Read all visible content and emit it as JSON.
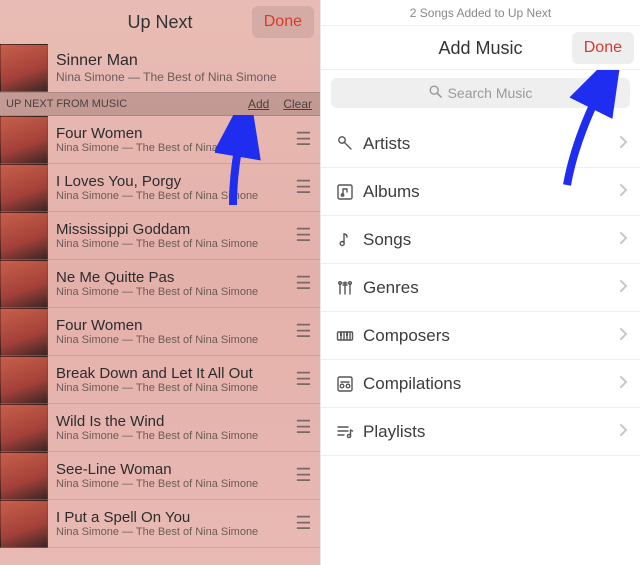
{
  "left": {
    "title": "Up Next",
    "done": "Done",
    "now_playing": {
      "title": "Sinner Man",
      "subtitle": "Nina Simone — The Best of Nina Simone"
    },
    "section_label": "UP NEXT FROM MUSIC",
    "add": "Add",
    "clear": "Clear",
    "queue": [
      {
        "title": "Four Women",
        "subtitle": "Nina Simone — The Best of Nina Simone"
      },
      {
        "title": "I Loves You, Porgy",
        "subtitle": "Nina Simone — The Best of Nina Simone"
      },
      {
        "title": "Mississippi Goddam",
        "subtitle": "Nina Simone — The Best of Nina Simone"
      },
      {
        "title": "Ne Me Quitte Pas",
        "subtitle": "Nina Simone — The Best of Nina Simone"
      },
      {
        "title": "Four Women",
        "subtitle": "Nina Simone — The Best of Nina Simone"
      },
      {
        "title": "Break Down and Let It All Out",
        "subtitle": "Nina Simone — The Best of Nina Simone"
      },
      {
        "title": "Wild Is the Wind",
        "subtitle": "Nina Simone — The Best of Nina Simone"
      },
      {
        "title": "See-Line Woman",
        "subtitle": "Nina Simone — The Best of Nina Simone"
      },
      {
        "title": "I Put a Spell On You",
        "subtitle": "Nina Simone — The Best of Nina Simone"
      }
    ]
  },
  "right": {
    "status": "2 Songs Added to Up Next",
    "title": "Add Music",
    "done": "Done",
    "search_placeholder": "Search Music",
    "categories": [
      {
        "icon": "mic-icon",
        "label": "Artists"
      },
      {
        "icon": "album-icon",
        "label": "Albums"
      },
      {
        "icon": "note-icon",
        "label": "Songs"
      },
      {
        "icon": "guitar-icon",
        "label": "Genres"
      },
      {
        "icon": "keyboard-icon",
        "label": "Composers"
      },
      {
        "icon": "compilation-icon",
        "label": "Compilations"
      },
      {
        "icon": "playlist-icon",
        "label": "Playlists"
      }
    ]
  }
}
